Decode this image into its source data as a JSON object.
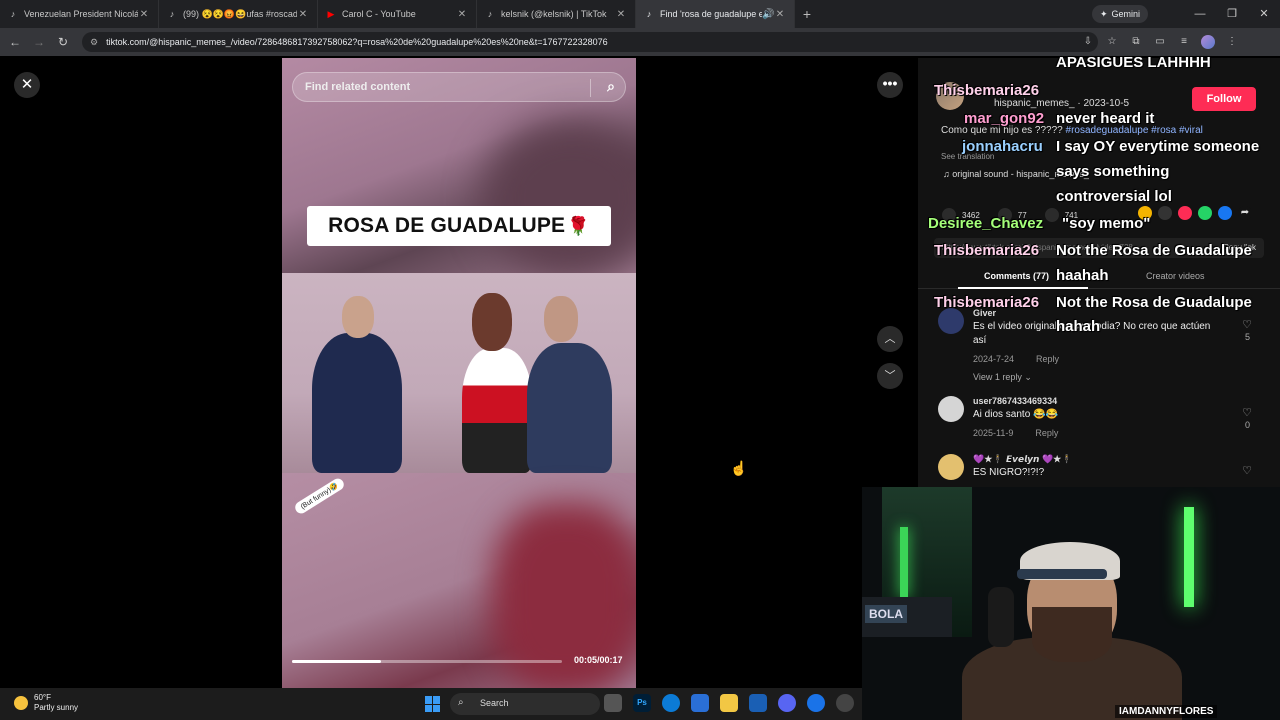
{
  "browser": {
    "tabs": [
      {
        "title": "Venezuelan President Nicolás M",
        "favicon": "tiktok-icon"
      },
      {
        "title": "(99) 😵😵😡😆ufas #roscaden",
        "favicon": "tiktok-icon"
      },
      {
        "title": "Carol C - YouTube",
        "favicon": "youtube-icon"
      },
      {
        "title": "kelsnik (@kelsnik) | TikTok",
        "favicon": "tiktok-icon"
      },
      {
        "title": "Find 'rosa de guadalupe es",
        "favicon": "tiktok-icon",
        "active": true
      }
    ],
    "gemini_label": "Gemini",
    "url": "tiktok.com/@hispanic_memes_/video/7286486817392758062?q=rosa%20de%20guadalupe%20es%20ne&t=1767722328076"
  },
  "video": {
    "search_placeholder": "Find related content",
    "overlay_title": "ROSA DE GUADALUPE",
    "sticker_text": "(But funny)🤣",
    "progress_fraction": 0.33,
    "timecode": "00:05/00:17"
  },
  "panel": {
    "author_handle": "hispanic_memes_",
    "post_date": "2023-10-5",
    "follow_label": "Follow",
    "caption_text": "Como que mi hijo es ?????",
    "caption_tags": [
      "#rosadeguadalupe",
      "#rosa",
      "#viral"
    ],
    "see_translation": "See translation",
    "sound": "original sound - hispanic_memes_",
    "likes": "3462",
    "comments_count": "77",
    "saves": "741",
    "link_text": "https://www.tiktok.com/@hispanic_memes_/video/728...",
    "copy_link": "Copy link",
    "tab_comments": "Comments (77)",
    "tab_creator": "Creator videos",
    "comments": [
      {
        "name": "Giver",
        "text": "Es el video original o es parodia? No creo que actúen así",
        "date": "2024-7-24",
        "reply": "Reply",
        "likes": "5"
      },
      {
        "name": "user7867433469334",
        "text": "Ai dios santo 😂😂",
        "date": "2025-11-9",
        "reply": "Reply",
        "likes": "0"
      },
      {
        "name": "💜★🕴 𝙀𝙫𝙚𝙡𝙮𝙣 💜★🕴",
        "text": "ES NIGRO?!?!?",
        "date": "",
        "reply": "",
        "likes": ""
      }
    ],
    "view_replies": "View 1 reply"
  },
  "chat": [
    {
      "user": "",
      "msg": "APASIGUES LAHHHH"
    },
    {
      "user": "Thisbemaria26",
      "msg": ""
    },
    {
      "user": "mar_gon92",
      "msg": "never heard it"
    },
    {
      "user": "jonnahacru",
      "msg": "I say OY everytime someone"
    },
    {
      "user": "",
      "msg": "says something"
    },
    {
      "user": "",
      "msg": "controversial lol"
    },
    {
      "user": "Desiree_Chavez",
      "msg": "\"soy memo\""
    },
    {
      "user": "Thisbemaria26",
      "msg": "Not the Rosa de Guadalupe"
    },
    {
      "user": "",
      "msg": "haahah"
    },
    {
      "user": "Thisbemaria26",
      "msg": "Not the Rosa de Guadalupe"
    },
    {
      "user": "",
      "msg": "hahah"
    }
  ],
  "webcam": {
    "sign": "BOLA",
    "handle": "IAMDANNYFLORES"
  },
  "taskbar": {
    "temp": "60°F",
    "condition": "Partly sunny",
    "search_label": "Search"
  },
  "colors": {
    "follow": "#fe2c55",
    "tag": "#8fb4ff",
    "chrome_dark": "#202124"
  }
}
